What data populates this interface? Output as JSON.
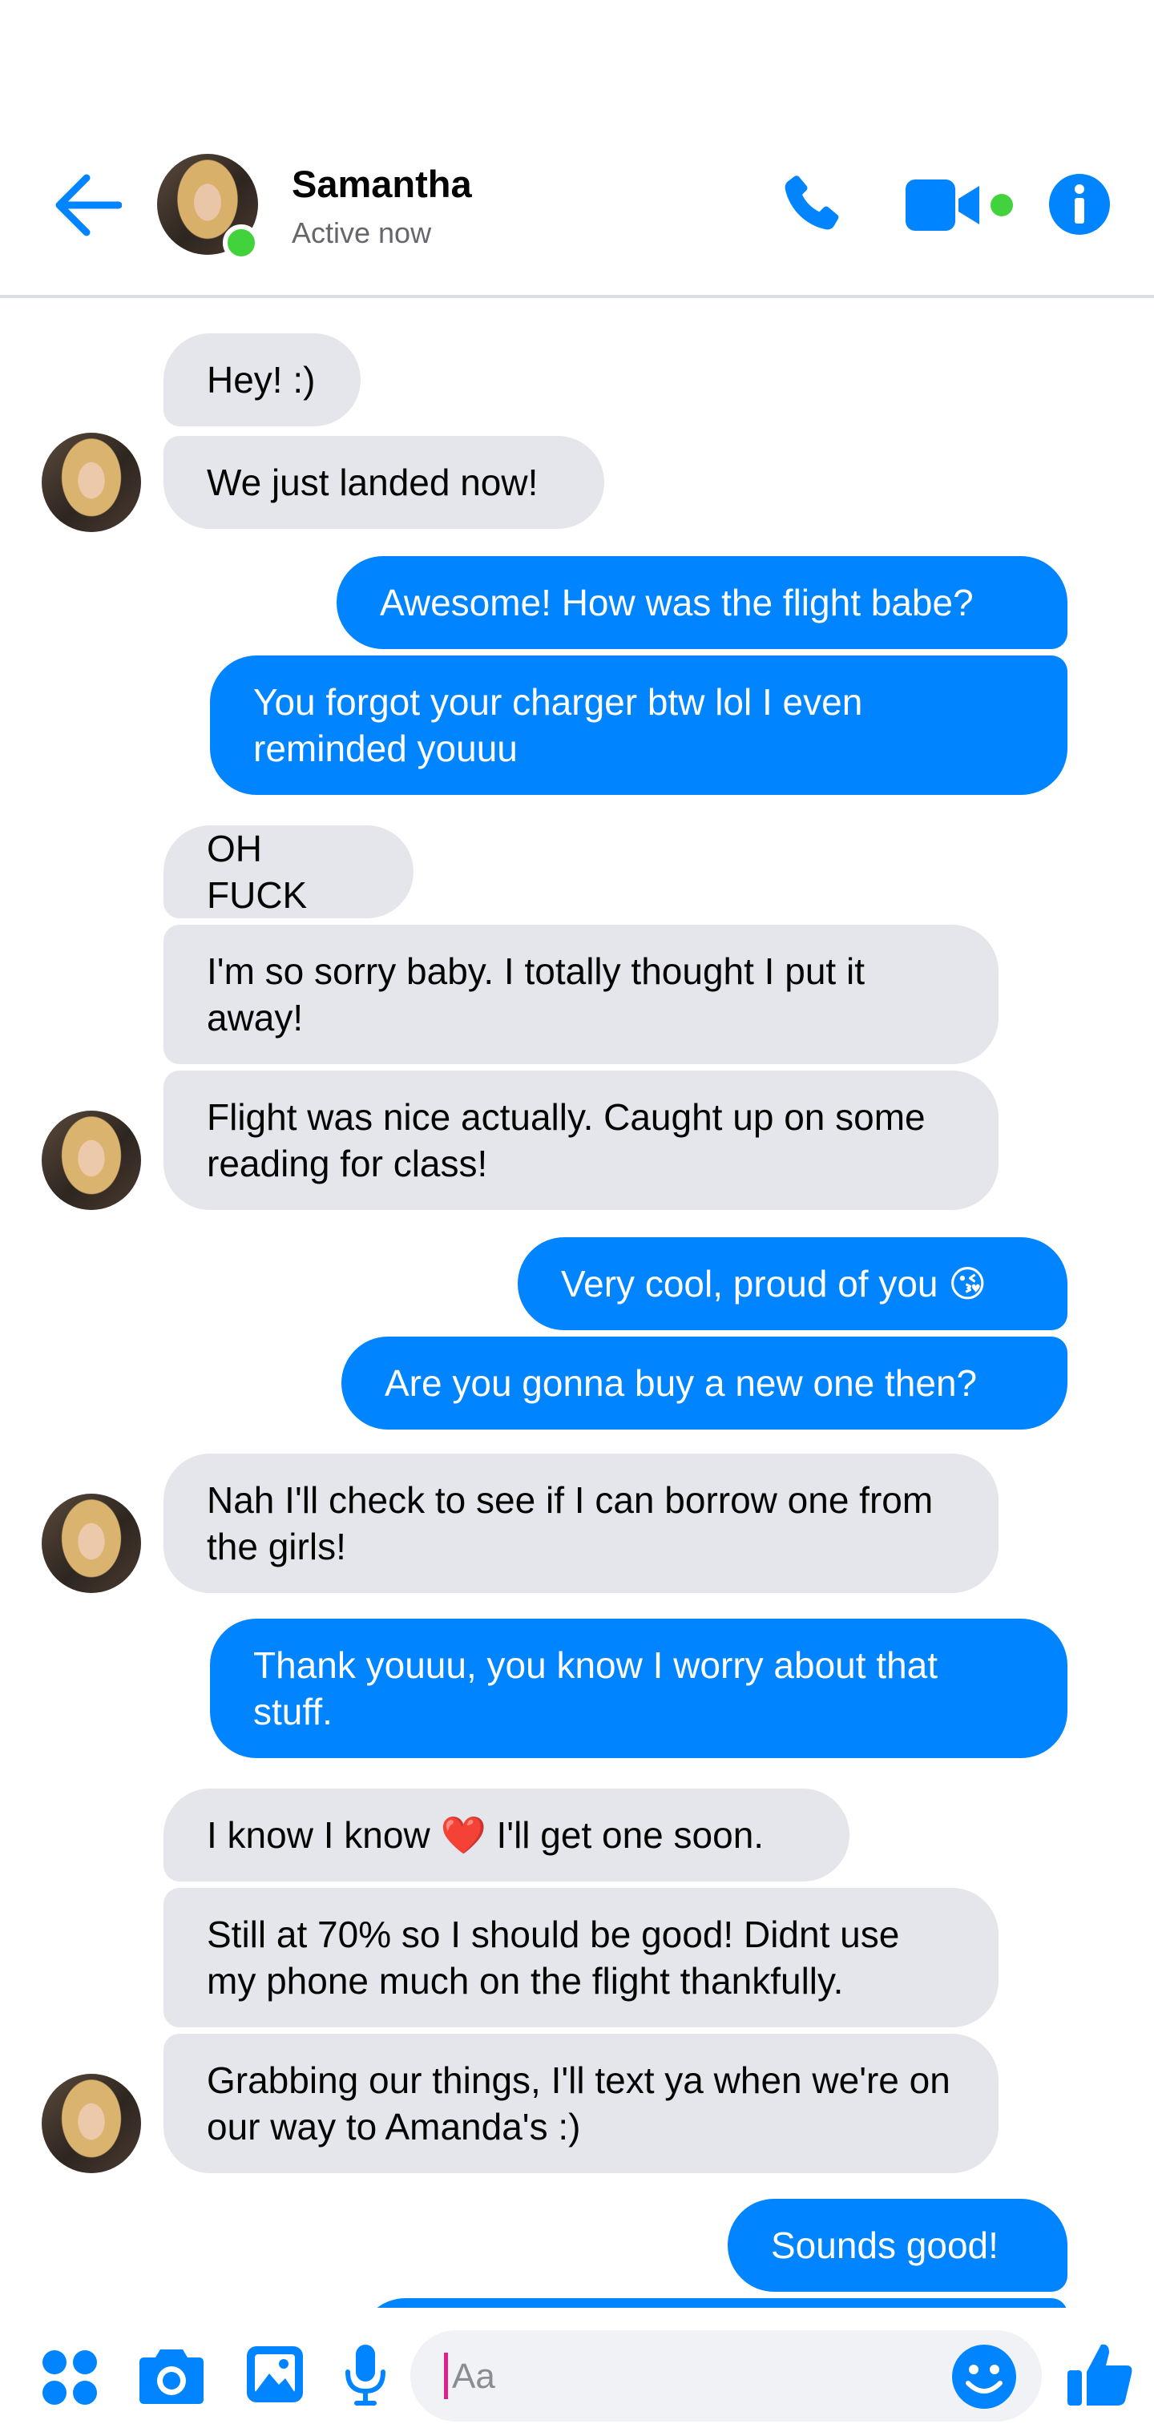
{
  "header": {
    "contact_name": "Samantha",
    "status": "Active now",
    "accent_color": "#0084ff",
    "online_color": "#42d33c",
    "icons": [
      "arrow-left-icon",
      "phone-icon",
      "video-camera-icon",
      "info-icon"
    ]
  },
  "messages": [
    {
      "sender": "contact",
      "text": "Hey! :)"
    },
    {
      "sender": "contact",
      "text": "We just landed now!"
    },
    {
      "sender": "me",
      "text": "Awesome! How was the flight babe?"
    },
    {
      "sender": "me",
      "text": "You forgot your charger btw lol I even reminded youuu"
    },
    {
      "sender": "contact",
      "text": "OH FUCK"
    },
    {
      "sender": "contact",
      "text": "I'm so sorry baby. I totally thought I put it away!"
    },
    {
      "sender": "contact",
      "text": "Flight was nice actually. Caught up on some reading for class!"
    },
    {
      "sender": "me",
      "text": "Very cool, proud of you 😘"
    },
    {
      "sender": "me",
      "text": "Are you gonna buy a new one then?"
    },
    {
      "sender": "contact",
      "text": "Nah I'll check to see if I can borrow one from the girls!"
    },
    {
      "sender": "me",
      "text": "Thank youuu, you know I worry about that stuff."
    },
    {
      "sender": "contact",
      "text": "I know I know ❤️ I'll get one soon."
    },
    {
      "sender": "contact",
      "text": "Still at 70% so I should be good! Didnt use my phone much on the flight thankfully."
    },
    {
      "sender": "contact",
      "text": "Grabbing our things, I'll text ya when we're on our way to Amanda's :)"
    },
    {
      "sender": "me",
      "text": "Sounds good!"
    }
  ],
  "composer": {
    "placeholder": "Aa",
    "icons": [
      "apps-icon",
      "camera-icon",
      "gallery-icon",
      "microphone-icon",
      "emoji-icon",
      "thumbs-up-icon"
    ]
  }
}
